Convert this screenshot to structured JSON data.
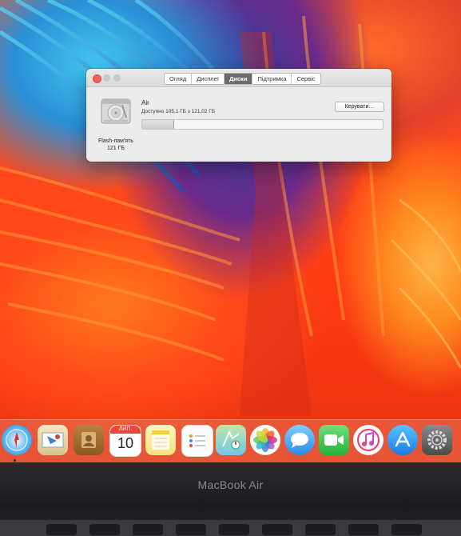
{
  "window": {
    "tabs": [
      {
        "label": "Огляд",
        "active": false
      },
      {
        "label": "Дисплеї",
        "active": false
      },
      {
        "label": "Диски",
        "active": true
      },
      {
        "label": "Підтримка",
        "active": false
      },
      {
        "label": "Сервіс",
        "active": false
      }
    ],
    "drive": {
      "label_line1": "Flash-пам'ять",
      "label_line2": "121 ГБ",
      "icon": "hard-drive-icon"
    },
    "volume": {
      "name": "Air",
      "free_text": "Доступно 105,1 ГБ з 121,02 ГБ",
      "used_fraction": 0.13
    },
    "manage_button": "Керувати…"
  },
  "dock": {
    "items": [
      {
        "name": "safari-icon"
      },
      {
        "name": "mail-icon"
      },
      {
        "name": "contacts-icon"
      },
      {
        "name": "calendar-icon",
        "month": "ЛИП.",
        "day": "10"
      },
      {
        "name": "notes-icon"
      },
      {
        "name": "reminders-icon"
      },
      {
        "name": "maps-icon"
      },
      {
        "name": "photos-icon"
      },
      {
        "name": "messages-icon"
      },
      {
        "name": "facetime-icon"
      },
      {
        "name": "itunes-icon"
      },
      {
        "name": "app-store-icon"
      },
      {
        "name": "system-preferences-icon"
      }
    ]
  },
  "bezel": {
    "brand": "MacBook Air"
  },
  "colors": {
    "accent_red": "#fc5f57",
    "active_tab": "#6b6b6b",
    "wallpaper_orange": "#ff5a22",
    "wallpaper_blue": "#2a8fd6"
  }
}
